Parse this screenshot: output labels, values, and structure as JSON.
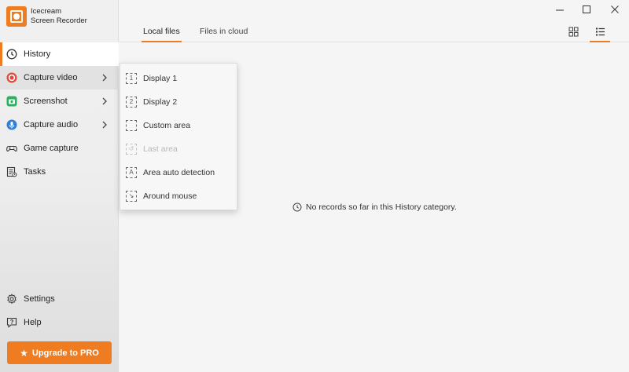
{
  "app": {
    "title_line1": "Icecream",
    "title_line2": "Screen Recorder",
    "logo_icon": "icecream-logo-icon"
  },
  "colors": {
    "accent": "#f07c22",
    "record_red": "#e2493a",
    "screenshot_green": "#29b35c",
    "audio_blue": "#2f7fd6"
  },
  "sidebar": {
    "items": [
      {
        "label": "History",
        "icon": "clock-icon"
      },
      {
        "label": "Capture video",
        "icon": "record-icon"
      },
      {
        "label": "Screenshot",
        "icon": "camera-icon"
      },
      {
        "label": "Capture audio",
        "icon": "microphone-icon"
      },
      {
        "label": "Game capture",
        "icon": "gamepad-icon"
      },
      {
        "label": "Tasks",
        "icon": "tasks-icon"
      }
    ],
    "bottom": [
      {
        "label": "Settings",
        "icon": "gear-icon"
      },
      {
        "label": "Help",
        "icon": "help-icon"
      }
    ],
    "upgrade_label": "Upgrade to PRO"
  },
  "tabs": [
    {
      "label": "Local files"
    },
    {
      "label": "Files in cloud"
    }
  ],
  "main": {
    "empty_message": "No records so far in this History category."
  },
  "capture_menu": {
    "items": [
      {
        "label": "Display 1",
        "glyph": "1",
        "enabled": true
      },
      {
        "label": "Display 2",
        "glyph": "2",
        "enabled": true
      },
      {
        "label": "Custom area",
        "glyph": "",
        "enabled": true
      },
      {
        "label": "Last area",
        "glyph": "↺",
        "enabled": false
      },
      {
        "label": "Area auto detection",
        "glyph": "A",
        "enabled": true
      },
      {
        "label": "Around mouse",
        "glyph": "↘",
        "enabled": true
      }
    ]
  }
}
